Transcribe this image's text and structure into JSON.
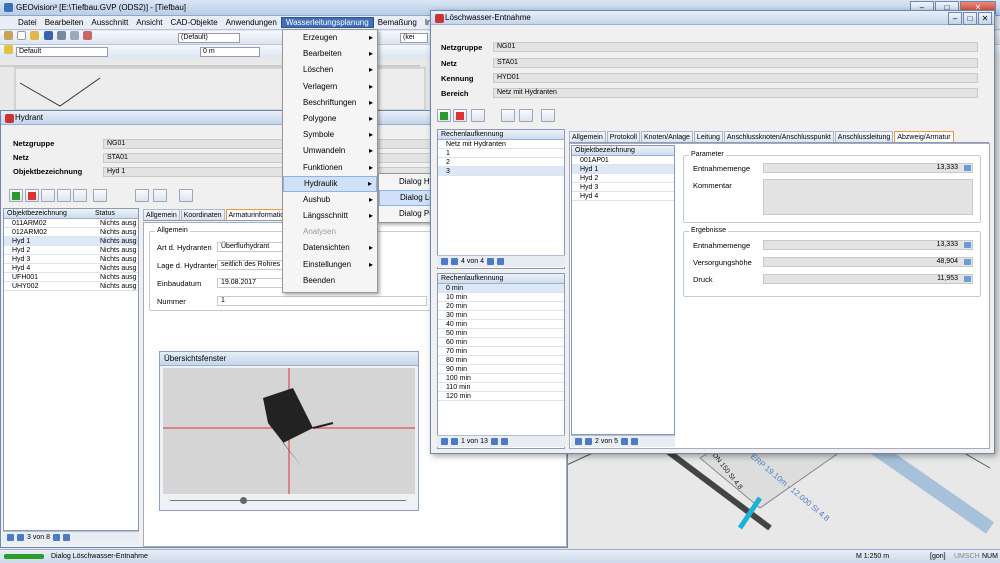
{
  "app": {
    "title": "GEOvision³ [E:\\Tiefbau.GVP (ODS2)] - [Tiefbau]"
  },
  "menubar": [
    "Datei",
    "Bearbeiten",
    "Ausschnitt",
    "Ansicht",
    "CAD-Objekte",
    "Anwendungen",
    "Wasserleitungsplanung",
    "Bemaßung",
    "Info"
  ],
  "toolbar": {
    "layer": "Default",
    "scale": "(Default)",
    "dist": "0 m",
    "dd_small": "(kei"
  },
  "wasser_menu": [
    "Erzeugen",
    "Bearbeiten",
    "Löschen",
    "Verlagern",
    "Beschriftungen",
    "Polygone",
    "Symbole",
    "Umwandeln",
    "Funktionen",
    "Hydraulik",
    "Aushub",
    "Längsschnitt",
    "Analysen",
    "Datensichten",
    "Einstellungen",
    "Beenden"
  ],
  "hydraulik_sub": [
    "Dialog Hydraulikberechnung",
    "Dialog Löschwasser-Entnahme",
    "Dialog Pumpenkennlinie"
  ],
  "hydrant": {
    "title": "Hydrant",
    "labels": [
      "Netzgruppe",
      "Netz",
      "Objektbezeichnung"
    ],
    "values": [
      "NG01",
      "STA01",
      "Hyd 1"
    ],
    "grid_headers": [
      "Objektbezeichnung",
      "Status"
    ],
    "rows": [
      [
        "011ARM02",
        "Nichts ausg"
      ],
      [
        "012ARM02",
        "Nichts ausg"
      ],
      [
        "Hyd 1",
        "Nichts ausg"
      ],
      [
        "Hyd 2",
        "Nichts ausg"
      ],
      [
        "Hyd 3",
        "Nichts ausg"
      ],
      [
        "Hyd 4",
        "Nichts ausg"
      ],
      [
        "UFH001",
        "Nichts ausg"
      ],
      [
        "ÜHY002",
        "Nichts ausg"
      ]
    ],
    "nav": "3 von 8",
    "tabs": [
      "Allgemein",
      "Koordinaten",
      "Armaturinformatio"
    ],
    "group": "Allgemein",
    "flabels": [
      "Art d. Hydranten",
      "Lage d. Hydranten",
      "Einbaudatum",
      "Nummer"
    ],
    "fvalues": [
      "Überflurhydrant",
      "seitlich des Rohres",
      "19.08.2017",
      "1"
    ],
    "overview": "Übersichtsfenster"
  },
  "lw": {
    "title": "Löschwasser-Entnahme",
    "labels": [
      "Netzgruppe",
      "Netz",
      "Kennung",
      "Bereich"
    ],
    "values": [
      "NG01",
      "STA01",
      "HYD01",
      "Netz mit Hydranten"
    ],
    "rk_header": "Rechenlaufkennung",
    "rk_rows": [
      "Netz mit Hydranten",
      "1",
      "2",
      "3"
    ],
    "rk_nav": "4 von 4",
    "rl_header": "Rechenlaufkennung",
    "rl_rows": [
      "0 min",
      "10 min",
      "20 min",
      "30 min",
      "40 min",
      "50 min",
      "60 min",
      "70 min",
      "80 min",
      "90 min",
      "100 min",
      "110 min",
      "120 min"
    ],
    "rl_nav": "1 von 13",
    "tabs": [
      "Allgemein",
      "Protokoll",
      "Knoten/Anlage",
      "Leitung",
      "Anschlussknoten/Anschlusspunkt",
      "Anschlussleitung",
      "Abzweig/Armatur"
    ],
    "ob_header": "Objektbezeichnung",
    "ob_rows": [
      "001AP01",
      "Hyd 1",
      "Hyd 2",
      "Hyd 3",
      "Hyd 4"
    ],
    "ob_nav": "2 von 5",
    "param": "Parameter",
    "p_labels": [
      "Entnahmemenge",
      "Kommentar"
    ],
    "p_value": "13,333",
    "erg": "Ergebnisse",
    "e_labels": [
      "Entnahmemenge",
      "Versorgungshöhe",
      "Druck"
    ],
    "e_values": [
      "13,333",
      "48,904",
      "11,953"
    ]
  },
  "map": {
    "pipe_label": "DN 150 St 4.8",
    "pipe_label2": "ERP 19.10m - 12.000 St 4.8"
  },
  "status": {
    "text": "Dialog Löschwasser-Entnahme",
    "scale": "M 1:250  m",
    "unit": "[gon]",
    "lock": "UMSCH",
    "num": "NUM"
  }
}
